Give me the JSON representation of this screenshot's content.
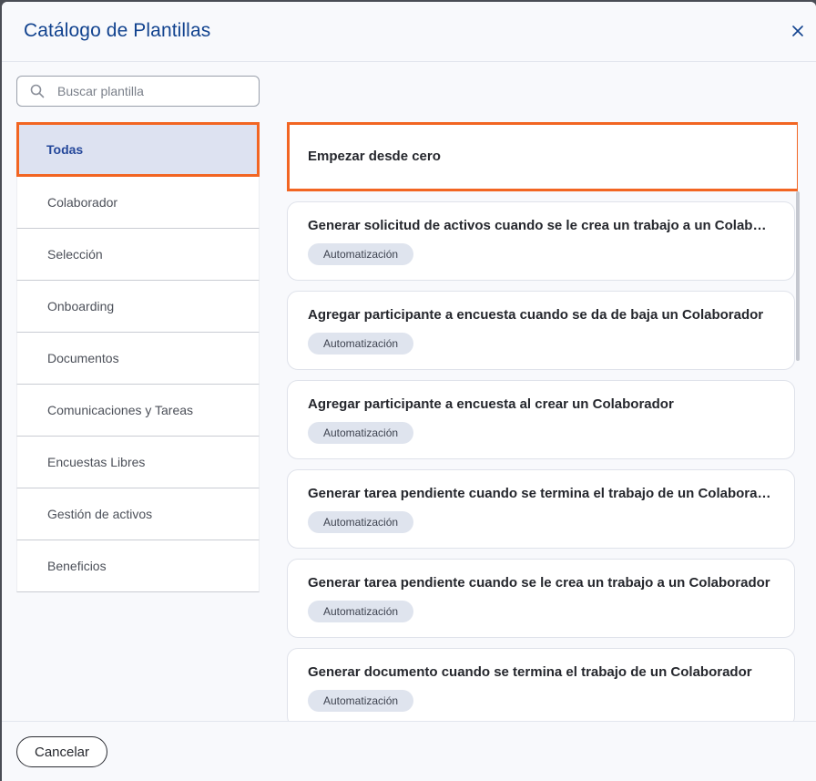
{
  "modal": {
    "title": "Catálogo de Plantillas",
    "close_icon": "close-icon"
  },
  "search": {
    "placeholder": "Buscar plantilla",
    "value": "",
    "icon": "search-icon"
  },
  "sidebar": {
    "items": [
      {
        "label": "Todas",
        "active": true
      },
      {
        "label": "Colaborador"
      },
      {
        "label": "Selección"
      },
      {
        "label": "Onboarding"
      },
      {
        "label": "Documentos"
      },
      {
        "label": "Comunicaciones y Tareas"
      },
      {
        "label": "Encuestas Libres"
      },
      {
        "label": "Gestión de activos"
      },
      {
        "label": "Beneficios"
      }
    ]
  },
  "templates": {
    "start_label": "Empezar desde cero",
    "items": [
      {
        "title": "Generar solicitud de activos cuando se le crea un trabajo a un Colaborador",
        "badge": "Automatización"
      },
      {
        "title": "Agregar participante a encuesta cuando se da de baja un Colaborador",
        "badge": "Automatización"
      },
      {
        "title": "Agregar participante a encuesta al crear un Colaborador",
        "badge": "Automatización"
      },
      {
        "title": "Generar tarea pendiente cuando se termina el trabajo de un Colaborador",
        "badge": "Automatización"
      },
      {
        "title": "Generar tarea pendiente cuando se le crea un trabajo a un Colaborador",
        "badge": "Automatización"
      },
      {
        "title": "Generar documento cuando se termina el trabajo de un Colaborador",
        "badge": "Automatización"
      }
    ]
  },
  "footer": {
    "cancel_label": "Cancelar"
  },
  "colors": {
    "accent": "#12438f",
    "highlight": "#f26522",
    "active_bg": "#dde2f1"
  }
}
